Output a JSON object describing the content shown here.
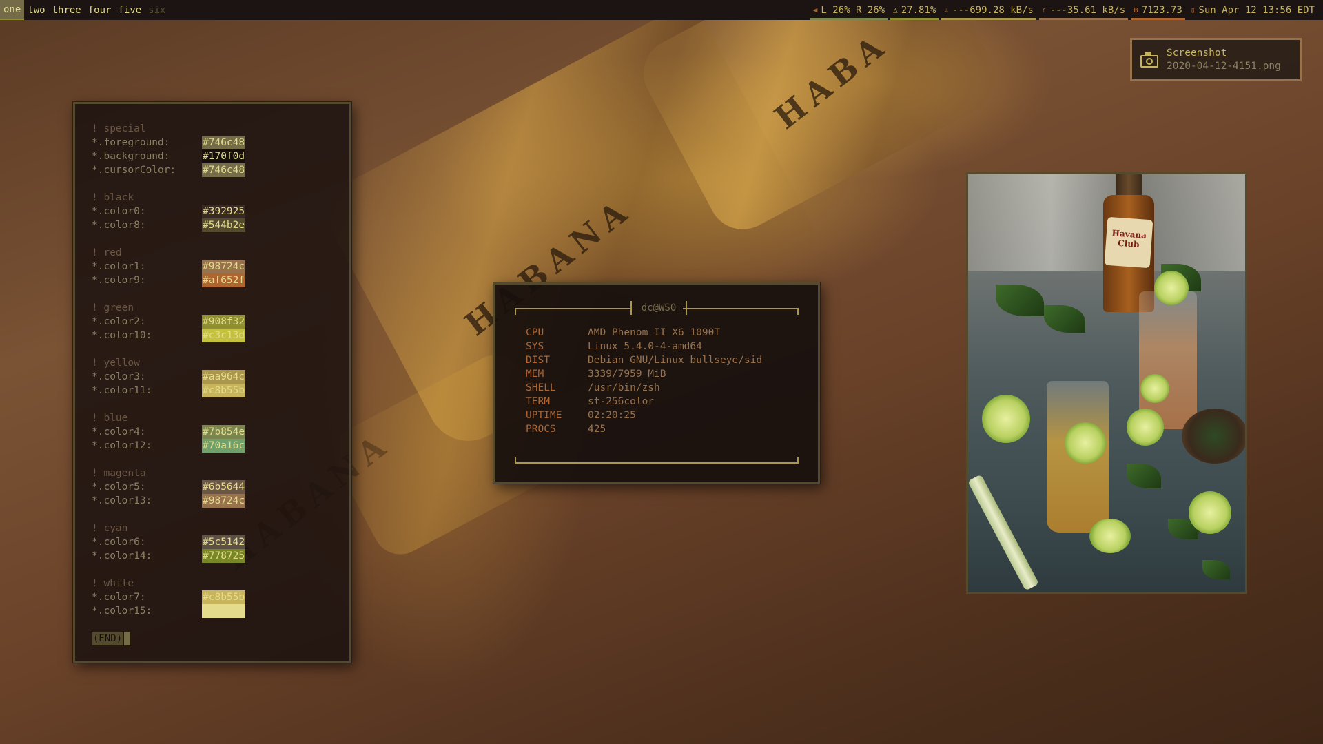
{
  "wallpaper": {
    "band_text_1": "HABANA",
    "band_text_2": "HABA",
    "band_text_3": "HABANA"
  },
  "topbar": {
    "workspaces": [
      {
        "label": "one",
        "state": "active"
      },
      {
        "label": "two",
        "state": "occupied"
      },
      {
        "label": "three",
        "state": "occupied"
      },
      {
        "label": "four",
        "state": "occupied"
      },
      {
        "label": "five",
        "state": "occupied"
      },
      {
        "label": "six",
        "state": "empty"
      }
    ],
    "volume": {
      "icon": "speaker-icon",
      "text": "L 26% R 26%"
    },
    "cpu": {
      "icon": "warning-icon",
      "text": "27.81%"
    },
    "net_down": {
      "icon": "down-arrow-icon",
      "text": "---699.28 kB/s"
    },
    "net_up": {
      "icon": "up-arrow-icon",
      "text": "---35.61 kB/s"
    },
    "balance": {
      "icon": "currency-icon",
      "text": "7123.73"
    },
    "datetime": {
      "icon": "clock-icon",
      "text": "Sun Apr 12 13:56 EDT"
    }
  },
  "xresources": {
    "end_label": "(END)",
    "groups": [
      {
        "comment": "! special",
        "entries": [
          {
            "key": "*.foreground:",
            "value": "#746c48"
          },
          {
            "key": "*.background:",
            "value": "#170f0d"
          },
          {
            "key": "*.cursorColor:",
            "value": "#746c48"
          }
        ]
      },
      {
        "comment": "! black",
        "entries": [
          {
            "key": "*.color0:",
            "value": "#392925"
          },
          {
            "key": "*.color8:",
            "value": "#544b2e"
          }
        ]
      },
      {
        "comment": "! red",
        "entries": [
          {
            "key": "*.color1:",
            "value": "#98724c"
          },
          {
            "key": "*.color9:",
            "value": "#af652f"
          }
        ]
      },
      {
        "comment": "! green",
        "entries": [
          {
            "key": "*.color2:",
            "value": "#908f32"
          },
          {
            "key": "*.color10:",
            "value": "#c3c13d"
          }
        ]
      },
      {
        "comment": "! yellow",
        "entries": [
          {
            "key": "*.color3:",
            "value": "#aa964c"
          },
          {
            "key": "*.color11:",
            "value": "#c8b55b"
          }
        ]
      },
      {
        "comment": "! blue",
        "entries": [
          {
            "key": "*.color4:",
            "value": "#7b854e"
          },
          {
            "key": "*.color12:",
            "value": "#70a16c"
          }
        ]
      },
      {
        "comment": "! magenta",
        "entries": [
          {
            "key": "*.color5:",
            "value": "#6b5644"
          },
          {
            "key": "*.color13:",
            "value": "#98724c"
          }
        ]
      },
      {
        "comment": "! cyan",
        "entries": [
          {
            "key": "*.color6:",
            "value": "#5c5142"
          },
          {
            "key": "*.color14:",
            "value": "#778725"
          }
        ]
      },
      {
        "comment": "! white",
        "entries": [
          {
            "key": "*.color7:",
            "value": "#c8b55b"
          },
          {
            "key": "*.color15:",
            "value": "#e4dc8c"
          }
        ]
      }
    ]
  },
  "fetch": {
    "title": "dc@WS0",
    "rows": [
      {
        "key": "CPU",
        "value": "AMD Phenom II X6 1090T"
      },
      {
        "key": "SYS",
        "value": "Linux 5.4.0-4-amd64"
      },
      {
        "key": "DIST",
        "value": "Debian GNU/Linux bullseye/sid"
      },
      {
        "key": "MEM",
        "value": "3339/7959 MiB"
      },
      {
        "key": "SHELL",
        "value": "/usr/bin/zsh"
      },
      {
        "key": "TERM",
        "value": "st-256color"
      },
      {
        "key": "UPTIME",
        "value": "02:20:25"
      },
      {
        "key": "PROCS",
        "value": "425"
      }
    ]
  },
  "notification": {
    "icon": "camera-icon",
    "title": "Screenshot",
    "body": "2020-04-12-4151.png"
  },
  "viewer": {
    "bottle_label": "Havana Club"
  },
  "colors": {
    "bar_bg": "#1c1412",
    "accent": "#c8b55b",
    "term_bg": "#170f0d",
    "border": "#544b2e"
  }
}
